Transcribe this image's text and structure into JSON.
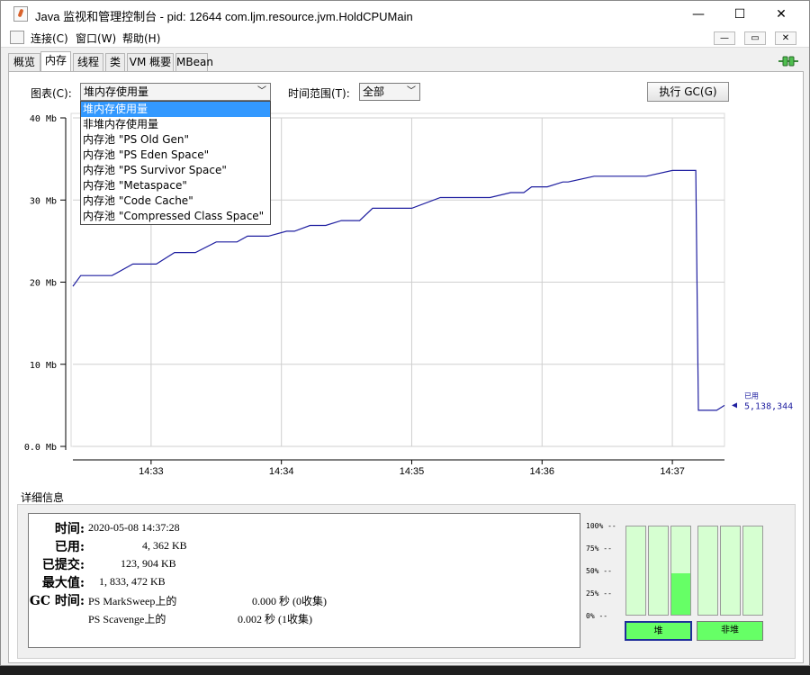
{
  "window": {
    "title": "Java 监视和管理控制台 - pid: 12644 com.ljm.resource.jvm.HoldCPUMain",
    "minimize": "—",
    "maximize": "☐",
    "close": "✕"
  },
  "menu": {
    "items": [
      "连接(C)",
      "窗口(W)",
      "帮助(H)"
    ],
    "sub_controls": [
      "—",
      "▭",
      "✕"
    ]
  },
  "tabs": [
    "概览",
    "内存",
    "线程",
    "类",
    "VM 概要",
    "MBean"
  ],
  "active_tab": "内存",
  "toolbar": {
    "chart_label": "图表(C):",
    "chart_value": "堆内存使用量",
    "range_label": "时间范围(T):",
    "range_value": "全部",
    "gc_button": "执行 GC(G)"
  },
  "dropdown": {
    "options": [
      "堆内存使用量",
      "非堆内存使用量",
      "内存池 \"PS Old Gen\"",
      "内存池 \"PS Eden Space\"",
      "内存池 \"PS Survivor Space\"",
      "内存池 \"Metaspace\"",
      "内存池 \"Code Cache\"",
      "内存池 \"Compressed Class Space\""
    ],
    "selected_index": 0
  },
  "chart_data": {
    "type": "line",
    "y_ticks": [
      "40 Mb",
      "30 Mb",
      "20 Mb",
      "10 Mb",
      "0.0 Mb"
    ],
    "y_tick_values": [
      40,
      30,
      20,
      10,
      0
    ],
    "x_ticks": [
      "14:33",
      "14:34",
      "14:35",
      "14:36",
      "14:37"
    ],
    "x_tick_values": [
      0.6,
      1.6,
      2.6,
      3.6,
      4.6
    ],
    "xlim": [
      0,
      5.0
    ],
    "ylim": [
      0,
      40
    ],
    "series": [
      {
        "name": "已用",
        "color": "#1f1fa0",
        "x": [
          0.0,
          0.06,
          0.3,
          0.46,
          0.64,
          0.78,
          0.94,
          1.1,
          1.26,
          1.34,
          1.5,
          1.64,
          1.7,
          1.82,
          1.94,
          2.06,
          2.2,
          2.3,
          2.38,
          2.46,
          2.6,
          2.82,
          2.9,
          3.0,
          3.2,
          3.36,
          3.46,
          3.52,
          3.6,
          3.64,
          3.76,
          3.8,
          4.0,
          4.12,
          4.2,
          4.32,
          4.4,
          4.6,
          4.78,
          4.8,
          4.88,
          4.94,
          5.0
        ],
        "y": [
          19.5,
          20.8,
          20.8,
          22.2,
          22.2,
          23.6,
          23.6,
          24.9,
          24.9,
          25.6,
          25.6,
          26.2,
          26.2,
          26.9,
          26.9,
          27.5,
          27.5,
          29.0,
          29.0,
          29.0,
          29.0,
          30.3,
          30.3,
          30.3,
          30.3,
          30.9,
          30.9,
          31.6,
          31.6,
          31.6,
          32.2,
          32.2,
          32.9,
          32.9,
          32.9,
          32.9,
          32.9,
          33.6,
          33.6,
          4.4,
          4.4,
          4.4,
          5.0
        ]
      }
    ],
    "grid": true,
    "end_label": "已用",
    "end_value": "5,138,344"
  },
  "details": {
    "title": "详细信息",
    "rows": [
      {
        "key": "时间:",
        "value": "2020-05-08 14:37:28"
      },
      {
        "key": "已用:",
        "value": "4, 362 KB"
      },
      {
        "key": "已提交:",
        "value": "123, 904 KB"
      },
      {
        "key": "最大值:",
        "value": "1, 833, 472 KB"
      }
    ],
    "gc_key": "GC 时间:",
    "gc_rows": [
      {
        "name": "PS MarkSweep上的",
        "value": "0.000  秒 (0收集)"
      },
      {
        "name": "PS Scavenge上的",
        "value": "0.002  秒 (1收集)"
      }
    ]
  },
  "bars": {
    "pct_labels": [
      "100% --",
      "75% --",
      "50% --",
      "25% --",
      "0% --"
    ],
    "heap_fills": [
      0.0,
      0.0,
      0.47
    ],
    "nonheap_fills": [
      0.0,
      0.0,
      0.0
    ],
    "heap_label": "堆",
    "nonheap_label": "非堆",
    "colors": {
      "empty": "#d6ffd1",
      "fill": "#66ff66"
    }
  }
}
